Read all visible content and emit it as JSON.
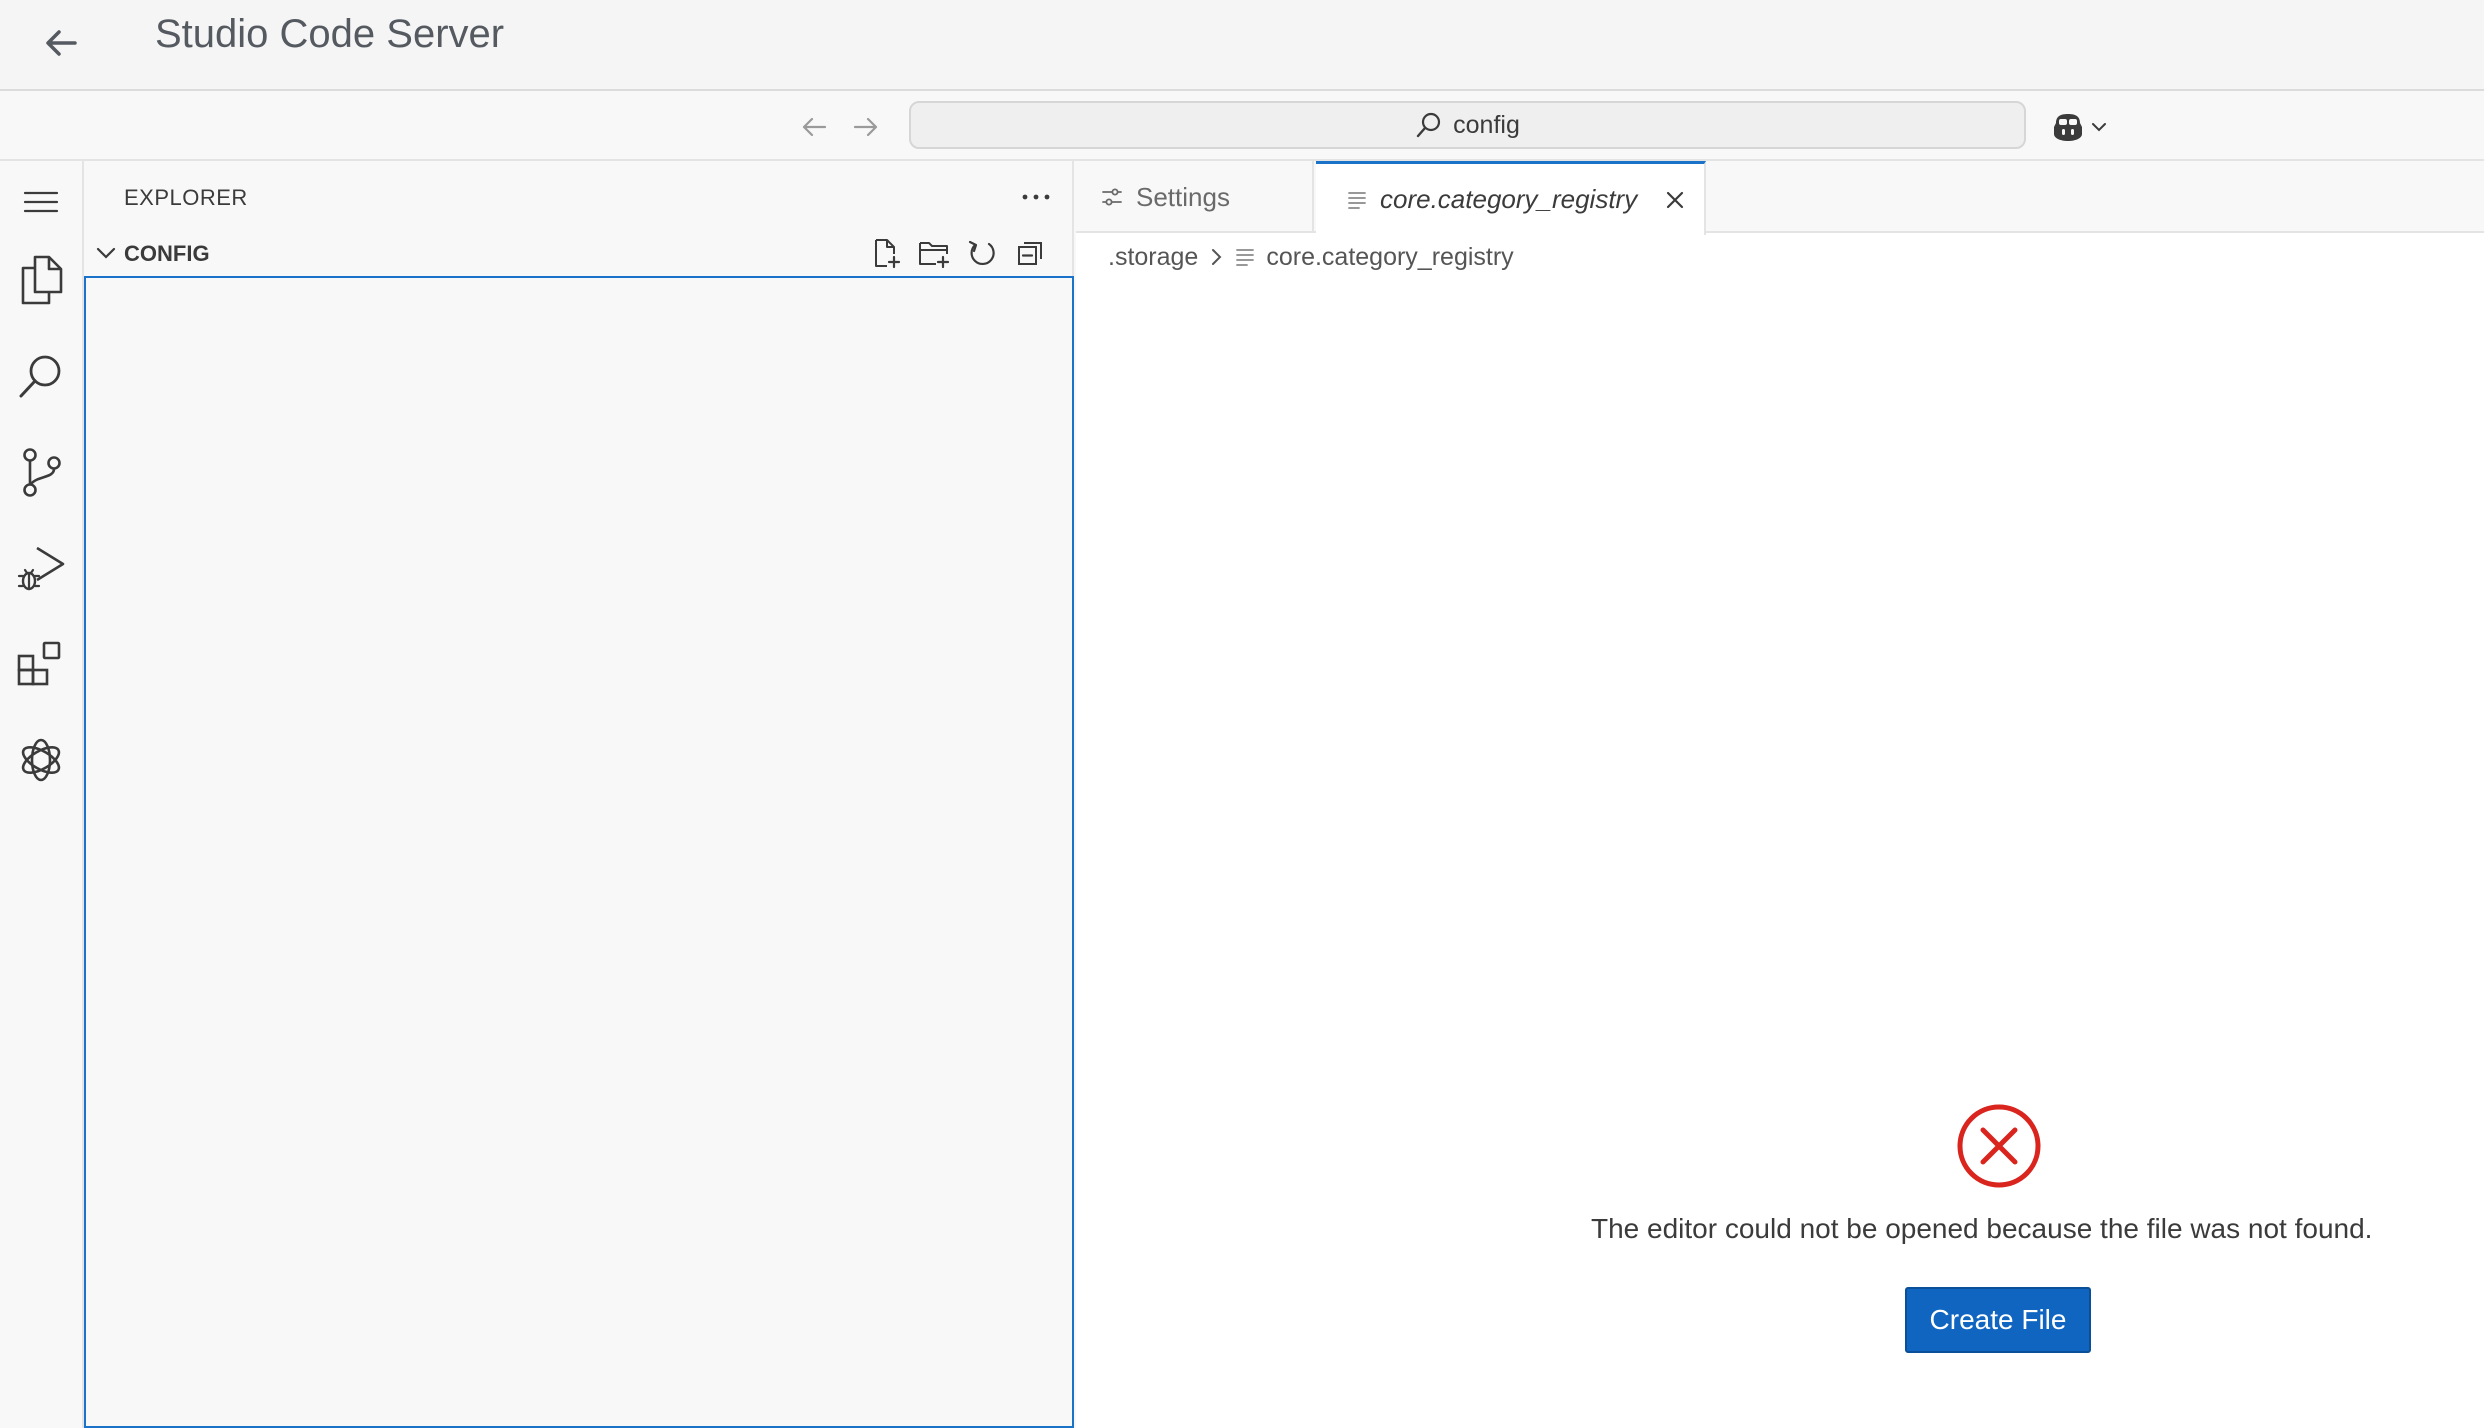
{
  "app_header": {
    "title": "Studio Code Server",
    "back_icon": "arrow-left-icon"
  },
  "titlebar": {
    "search_text": "config",
    "search_icon": "search-icon",
    "copilot_icon": "copilot-icon"
  },
  "activity_bar": {
    "items": [
      {
        "name": "menu",
        "icon": "hamburger-menu-icon"
      },
      {
        "name": "explorer",
        "icon": "files-icon"
      },
      {
        "name": "search",
        "icon": "search-icon"
      },
      {
        "name": "source-control",
        "icon": "source-control-icon"
      },
      {
        "name": "run-debug",
        "icon": "run-debug-icon"
      },
      {
        "name": "extensions",
        "icon": "extensions-icon"
      },
      {
        "name": "chatgpt",
        "icon": "openai-icon"
      }
    ]
  },
  "sidebar": {
    "title": "EXPLORER",
    "section_title": "CONFIG",
    "actions": [
      "new-file-icon",
      "new-folder-icon",
      "refresh-icon",
      "collapse-all-icon"
    ]
  },
  "tabs": [
    {
      "label": "Settings",
      "icon": "settings-icon",
      "active": false
    },
    {
      "label": "core.category_registry",
      "icon": "file-lines-icon",
      "active": true
    }
  ],
  "breadcrumb": {
    "folder": ".storage",
    "file": "core.category_registry"
  },
  "error": {
    "message": "The editor could not be opened because the file was not found.",
    "button_label": "Create File",
    "icon_color": "#d9251d"
  },
  "colors": {
    "accent": "#1a73c8",
    "button": "#0f65c0"
  }
}
